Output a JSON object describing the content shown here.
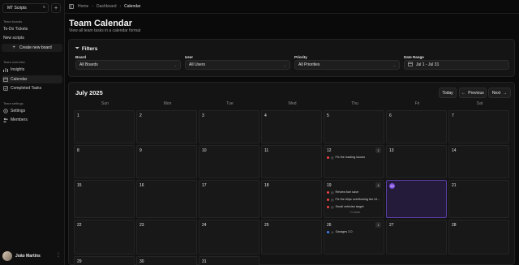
{
  "sidebar": {
    "workspace": "MT Scripts",
    "add_symbol": "+",
    "section_boards": "Team boards",
    "boards": [
      "To-Do Tickets",
      "New scripts"
    ],
    "new_board_label": "Create new board",
    "section_overview": "Team overview",
    "overview_items": [
      "Insights",
      "Calendar",
      "Completed Tasks"
    ],
    "section_settings": "Team settings",
    "settings_items": [
      "Settings",
      "Members"
    ],
    "user_name": "João Martins"
  },
  "breadcrumb": {
    "home": "Home",
    "dashboard": "Dashboard",
    "current": "Calendar",
    "separator": "›"
  },
  "page": {
    "title": "Team Calendar",
    "subtitle": "View all team tasks in a calendar format"
  },
  "filters": {
    "title": "Filters",
    "board": {
      "label": "Board",
      "value": "All Boards"
    },
    "user": {
      "label": "User",
      "value": "All Users"
    },
    "priority": {
      "label": "Priority",
      "value": "All Priorities"
    },
    "date_range": {
      "label": "Date Range",
      "value": "Jul 1 - Jul 31"
    }
  },
  "calendar": {
    "month": "July 2025",
    "today_label": "Today",
    "prev_label": "Previous",
    "next_label": "Next",
    "weekdays": [
      "Sun",
      "Mon",
      "Tue",
      "Wed",
      "Thu",
      "Fri",
      "Sat"
    ],
    "today_day": "20",
    "weeks": [
      [
        {
          "day": "1"
        },
        {
          "day": "2"
        },
        {
          "day": "3"
        },
        {
          "day": "4"
        },
        {
          "day": "5"
        },
        {
          "day": "6"
        },
        {
          "day": "7"
        }
      ],
      [
        {
          "day": "8"
        },
        {
          "day": "9"
        },
        {
          "day": "10"
        },
        {
          "day": "11"
        },
        {
          "day": "12",
          "count": "1",
          "tasks": [
            {
              "text": "Fix the loading issues",
              "dot": "#ef4444",
              "status": "◷"
            }
          ]
        },
        {
          "day": "13"
        },
        {
          "day": "14"
        }
      ],
      [
        {
          "day": "15"
        },
        {
          "day": "16"
        },
        {
          "day": "17"
        },
        {
          "day": "18"
        },
        {
          "day": "19",
          "count": "4",
          "tasks": [
            {
              "text": "Review fuel save",
              "dot": "#ef4444",
              "status": "◷"
            },
            {
              "text": "Fix the blips overflowing the UI...",
              "dot": "#ef4444",
              "status": "◷"
            },
            {
              "text": "Small vehicles target",
              "dot": "#ef4444",
              "status": "◷"
            }
          ],
          "more": "+1 more"
        },
        {
          "day": "20",
          "today": true
        },
        {
          "day": "21"
        }
      ],
      [
        {
          "day": "22"
        },
        {
          "day": "23"
        },
        {
          "day": "24"
        },
        {
          "day": "25"
        },
        {
          "day": "26",
          "count": "1",
          "tasks": [
            {
              "text": "Garages 2.0",
              "dot": "#3b82f6",
              "status": "⚠"
            }
          ]
        },
        {
          "day": "27"
        },
        {
          "day": "28"
        }
      ],
      [
        {
          "day": "29"
        },
        {
          "day": "30"
        },
        {
          "day": "31"
        },
        {
          "day": ""
        },
        {
          "day": ""
        },
        {
          "day": ""
        },
        {
          "day": ""
        }
      ]
    ]
  },
  "colors": {
    "accent": "#7c4ddb",
    "priority_high": "#ef4444",
    "priority_low": "#3b82f6"
  }
}
